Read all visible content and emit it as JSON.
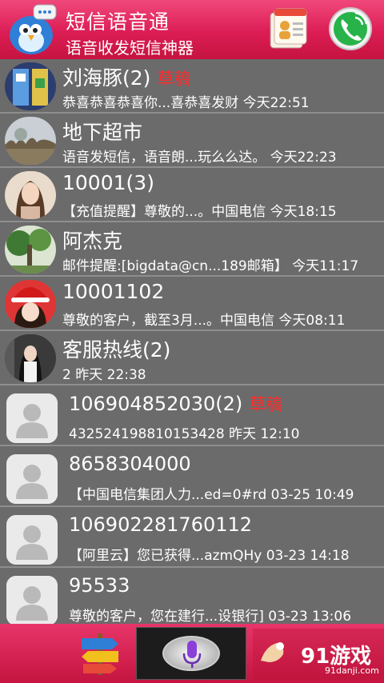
{
  "app": {
    "title": "短信语音通",
    "subtitle": "语音收发短信神器"
  },
  "conversations": [
    {
      "name": "刘海豚(2)",
      "draft": "草稿",
      "preview": "恭喜恭喜恭喜你...喜恭喜发财 今天22:51",
      "avatar": "photo-kids-icon"
    },
    {
      "name": "地下超市",
      "draft": "",
      "preview": "语音发短信，语音朗...玩么么达。 今天22:23",
      "avatar": "photo-landscape-icon"
    },
    {
      "name": "10001(3)",
      "draft": "",
      "preview": "【充值提醒】尊敬的...。中国电信 今天18:15",
      "avatar": "photo-woman-icon"
    },
    {
      "name": "阿杰克",
      "draft": "",
      "preview": "邮件提醒:[bigdata@cn...189邮箱】 今天11:17",
      "avatar": "photo-tree-icon"
    },
    {
      "name": "10001102",
      "draft": "",
      "preview": "尊敬的客户，截至3月...。中国电信 今天08:11",
      "avatar": "photo-santa-girl-icon"
    },
    {
      "name": "客服热线(2)",
      "draft": "",
      "preview": "2 昨天 22:38",
      "avatar": "photo-girl-icon"
    },
    {
      "name": "106904852030(2)",
      "draft": "草稿",
      "preview": "432524198810153428 昨天 12:10",
      "avatar": "default-contact-icon"
    },
    {
      "name": "8658304000",
      "draft": "",
      "preview": "【中国电信集团人力...ed=0#rd 03-25 10:49",
      "avatar": "default-contact-icon"
    },
    {
      "name": "106902281760112",
      "draft": "",
      "preview": "【阿里云】您已获得...azmQHy 03-23 14:18",
      "avatar": "default-contact-icon"
    },
    {
      "name": "95533",
      "draft": "",
      "preview": "尊敬的客户，您在建行...设银行] 03-23 13:06",
      "avatar": "default-contact-icon"
    }
  ],
  "bottom_bar": {
    "brand_logo_text": "91游戏",
    "brand_logo_sub": "91danji.com"
  },
  "colors": {
    "header_red": "#dc1d55",
    "list_bg": "#6b6b6b",
    "draft_red": "#ff2a2a"
  }
}
